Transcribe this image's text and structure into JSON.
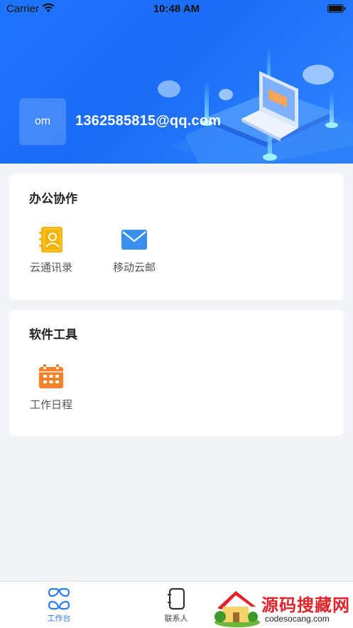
{
  "status_bar": {
    "carrier": "Carrier",
    "time": "10:48 AM"
  },
  "header": {
    "avatar_text": "om",
    "email": "1362585815@qq.com",
    "accent": "#1f74ff"
  },
  "sections": [
    {
      "title": "办公协作",
      "items": [
        {
          "label": "云通讯录",
          "icon": "contacts-book-icon",
          "color": "#f5b301"
        },
        {
          "label": "移动云邮",
          "icon": "mail-icon",
          "color": "#3a8ff0"
        }
      ]
    },
    {
      "title": "软件工具",
      "items": [
        {
          "label": "工作日程",
          "icon": "calendar-icon",
          "color": "#f5812c"
        }
      ]
    }
  ],
  "tabbar": {
    "tabs": [
      {
        "label": "工作台",
        "icon": "workbench-icon",
        "active": true
      },
      {
        "label": "联系人",
        "icon": "contacts-icon",
        "active": false
      }
    ],
    "active_color": "#2a7bf6"
  },
  "watermark": {
    "text_cn": "源码搜藏网",
    "text_en": "codesocang.com"
  }
}
